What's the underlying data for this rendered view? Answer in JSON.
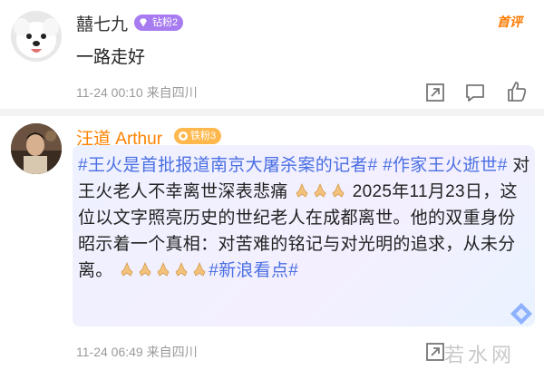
{
  "comments": [
    {
      "username": "囍七九",
      "badge": "钻粉2",
      "tag": "首评",
      "text": "一路走好",
      "time": "11-24 00:10",
      "location": "来自四川"
    },
    {
      "username": "汪道 Arthur",
      "badge": "铁粉3",
      "segments": {
        "s1": "#王火是首批报道南京大屠杀案的记者#",
        "s2": " #作家王火逝世#",
        "s3": " 对王火老人不幸离世深表悲痛",
        "s4": " 2025年11月23日，这位以文字照亮历史的世纪老人在成都离世。他的双重身份昭示着一个真相：对苦难的铭记与对光明的追求，从未分离。",
        "s5": "#新浪看点#"
      },
      "time": "11-24 06:49",
      "location": "来自四川"
    }
  ],
  "icons": {
    "badge1": "diamond-icon",
    "badge2": "iron-fan-icon",
    "share": "share-icon",
    "reply": "comment-icon",
    "like": "like-icon",
    "emoji": "praying-hands-icon"
  },
  "watermark": "若水网",
  "colors": {
    "username_orange": "#ff8200",
    "hashtag_blue": "#4a6fe3",
    "meta_gray": "#9a9a9a"
  }
}
